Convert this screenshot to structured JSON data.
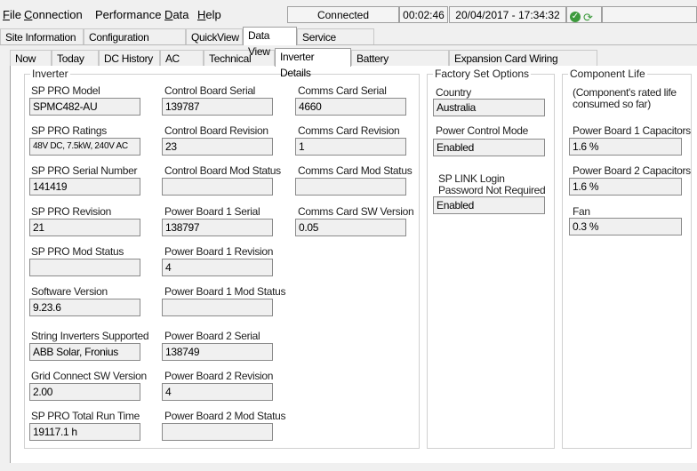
{
  "menu": {
    "file": {
      "key": "F",
      "rest": "ile"
    },
    "connection": {
      "key": "C",
      "rest": "onnection"
    },
    "performance": {
      "pre": "Performance ",
      "key": "D",
      "rest": "ata"
    },
    "help": {
      "key": "H",
      "rest": "elp"
    }
  },
  "status": {
    "connection": "Connected",
    "elapsed": "00:02:46",
    "datetime": "20/04/2017 - 17:34:32"
  },
  "main_tabs": [
    "Site Information",
    "Configuration Settings",
    "QuickView",
    "Data View",
    "Service Settings"
  ],
  "main_active": "Data View",
  "sub_tabs": [
    "Now",
    "Today",
    "DC History",
    "AC History",
    "Technical Data",
    "Inverter Details",
    "Battery Management",
    "Expansion Card Wiring Diagram"
  ],
  "sub_active": "Inverter Details",
  "inverter": {
    "title": "Inverter",
    "col1": [
      {
        "label": "SP PRO Model",
        "value": "SPMC482-AU"
      },
      {
        "label": "SP PRO Ratings",
        "value": "48V DC, 7.5kW, 240V AC"
      },
      {
        "label": "SP PRO Serial Number",
        "value": "141419"
      },
      {
        "label": "SP PRO Revision",
        "value": "21"
      },
      {
        "label": "SP PRO Mod Status",
        "value": ""
      },
      {
        "label": "Software Version",
        "value": "9.23.6"
      },
      {
        "label": "String Inverters Supported",
        "value": "ABB Solar, Fronius"
      },
      {
        "label": "Grid Connect SW Version",
        "value": "2.00"
      },
      {
        "label": "SP PRO Total Run Time",
        "value": "19117.1 h"
      }
    ],
    "col2": [
      {
        "label": "Control Board Serial",
        "value": "139787"
      },
      {
        "label": "Control Board Revision",
        "value": "23"
      },
      {
        "label": "Control Board Mod Status",
        "value": ""
      },
      {
        "label": "Power Board 1 Serial",
        "value": "138797"
      },
      {
        "label": "Power Board 1 Revision",
        "value": "4"
      },
      {
        "label": "Power Board 1 Mod Status",
        "value": ""
      },
      {
        "label": "Power Board 2 Serial",
        "value": "138749"
      },
      {
        "label": "Power Board 2 Revision",
        "value": "4"
      },
      {
        "label": "Power Board 2 Mod Status",
        "value": ""
      }
    ],
    "col3": [
      {
        "label": "Comms Card Serial",
        "value": "4660"
      },
      {
        "label": "Comms Card Revision",
        "value": "1"
      },
      {
        "label": "Comms Card Mod Status",
        "value": ""
      },
      {
        "label": "Comms Card SW Version",
        "value": "0.05"
      }
    ]
  },
  "factory": {
    "title": "Factory Set Options",
    "country_label": "Country",
    "country_value": "Australia",
    "power_control_label": "Power Control Mode",
    "power_control_value": "Enabled",
    "splink_label_1": "SP LINK Login",
    "splink_label_2": "Password Not Required",
    "splink_value": "Enabled"
  },
  "component_life": {
    "title": "Component Life",
    "note_1": "(Component's rated life",
    "note_2": "consumed so far)",
    "items": [
      {
        "label": "Power Board 1 Capacitors",
        "value": "1.6 %"
      },
      {
        "label": "Power Board 2 Capacitors",
        "value": "1.6 %"
      },
      {
        "label": "Fan",
        "value": "0.3 %"
      }
    ]
  },
  "colors": {
    "ok_green": "#3c9a3c",
    "field_bg": "#f0f0f0",
    "tab_border": "#a0a0a0"
  },
  "icons": [
    "ok-check-icon",
    "refresh-icon"
  ]
}
